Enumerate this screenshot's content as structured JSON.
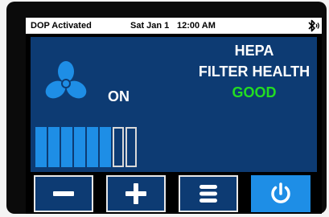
{
  "status_bar": {
    "mode": "DOP Activated",
    "date": "Sat Jan 1",
    "time": "12:00 AM",
    "bluetooth_icon": "bluetooth-icon"
  },
  "fan": {
    "icon": "fan-icon",
    "state": "ON",
    "speed_level": 6,
    "speed_max": 8
  },
  "filter": {
    "line1": "HEPA",
    "line2": "FILTER HEALTH",
    "status": "GOOD",
    "status_color": "#22dd22"
  },
  "controls": [
    {
      "name": "decrease-button",
      "icon": "minus-icon"
    },
    {
      "name": "increase-button",
      "icon": "plus-icon"
    },
    {
      "name": "menu-button",
      "icon": "menu-icon"
    },
    {
      "name": "power-button",
      "icon": "power-icon"
    }
  ],
  "colors": {
    "panel": "#0d3b73",
    "accent": "#1e8ee6",
    "good": "#22dd22"
  }
}
